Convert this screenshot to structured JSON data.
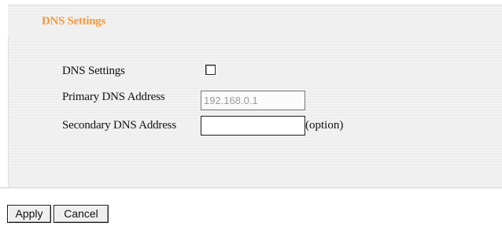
{
  "header": {
    "title": "DNS Settings"
  },
  "form": {
    "dns_settings_label": "DNS Settings",
    "dns_settings_checked": false,
    "primary_dns_label": "Primary DNS Address",
    "primary_dns_value": "192.168.0.1",
    "secondary_dns_label": "Secondary DNS Address",
    "secondary_dns_value": "",
    "secondary_dns_hint": "(option)"
  },
  "actions": {
    "apply_label": "Apply",
    "cancel_label": "Cancel"
  },
  "colors": {
    "title_accent": "#f39a3b",
    "panel_background": "#f1f1f1"
  }
}
